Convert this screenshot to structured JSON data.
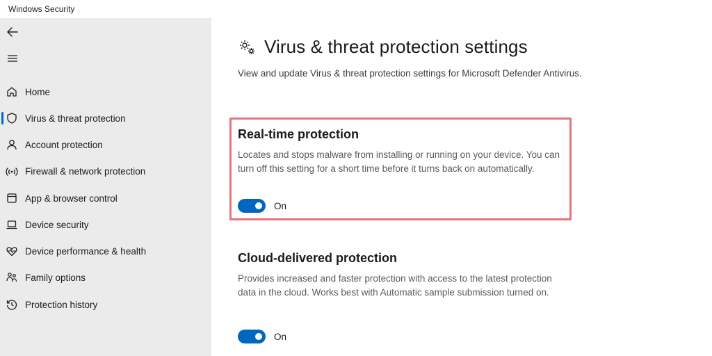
{
  "window": {
    "title": "Windows Security"
  },
  "sidebar": {
    "back_icon": "back-arrow-icon",
    "menu_icon": "hamburger-icon",
    "items": [
      {
        "label": "Home",
        "icon": "home-icon"
      },
      {
        "label": "Virus & threat protection",
        "icon": "shield-icon",
        "active": true
      },
      {
        "label": "Account protection",
        "icon": "person-icon"
      },
      {
        "label": "Firewall & network protection",
        "icon": "wifi-signal-icon"
      },
      {
        "label": "App & browser control",
        "icon": "app-window-icon"
      },
      {
        "label": "Device security",
        "icon": "laptop-icon"
      },
      {
        "label": "Device performance & health",
        "icon": "heart-pulse-icon"
      },
      {
        "label": "Family options",
        "icon": "family-icon"
      },
      {
        "label": "Protection history",
        "icon": "history-icon"
      }
    ]
  },
  "main": {
    "title": "Virus & threat protection settings",
    "title_icon": "gears-icon",
    "description": "View and update Virus & threat protection settings for Microsoft Defender Antivirus.",
    "sections": [
      {
        "title": "Real-time protection",
        "description": "Locates and stops malware from installing or running on your device. You can turn off this setting for a short time before it turns back on automatically.",
        "toggle_state": "On",
        "toggle_on": true,
        "highlighted": true
      },
      {
        "title": "Cloud-delivered protection",
        "description": "Provides increased and faster protection with access to the latest protection data in the cloud. Works best with Automatic sample submission turned on.",
        "toggle_state": "On",
        "toggle_on": true,
        "highlighted": false
      }
    ]
  },
  "colors": {
    "accent": "#0067c0",
    "highlight_border": "#e8737a",
    "sidebar_bg": "#ebebeb"
  }
}
